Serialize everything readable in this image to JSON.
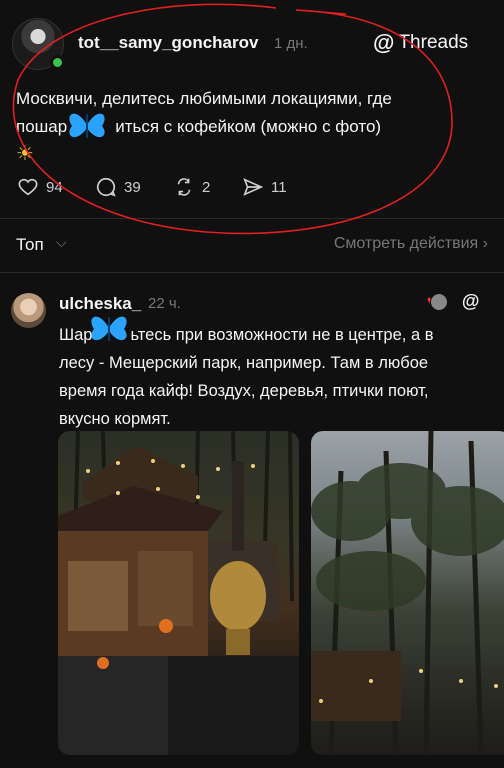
{
  "post": {
    "username": "tot__samy_goncharov",
    "time": "1 дн.",
    "threads_label": "Threads",
    "text": "Москвичи, делитесь любимыми локациями, где пошарриться с кофейком (можно с фото)",
    "text_line1": "Москвичи, делитесь любимыми локациями, где",
    "text_line2_a": "пошар",
    "text_line2_b": "иться с кофейком (можно с фото)",
    "likes": "94",
    "comments": "39",
    "reposts": "2",
    "shares": "11"
  },
  "sortbar": {
    "sort_label": "Топ",
    "view_actions": "Смотреть действия"
  },
  "reply": {
    "username": "ulcheska_",
    "time": "22 ч.",
    "text_line1_a": "Шар",
    "text_line1_b": "ьтесь при возможности не в центре, а в",
    "text_line2": "лесу - Мещерский парк, например. Там в любое",
    "text_line3": "время года кайф! Воздух, деревья, птички поют,",
    "text_line4": "вкусно кормят."
  },
  "icons": {
    "like": "heart-icon",
    "comment": "comment-icon",
    "repost": "repost-icon",
    "share": "share-icon",
    "threads": "threads-icon",
    "sun": "sun-emoji",
    "butterfly": "butterfly-emoji"
  },
  "colors": {
    "background": "#101010",
    "text": "#f3f5f7",
    "muted": "#777777",
    "annotation_red": "#e02020",
    "online": "#3bc24a",
    "butterfly": "#2aa3ff",
    "heart": "#ff3040"
  }
}
